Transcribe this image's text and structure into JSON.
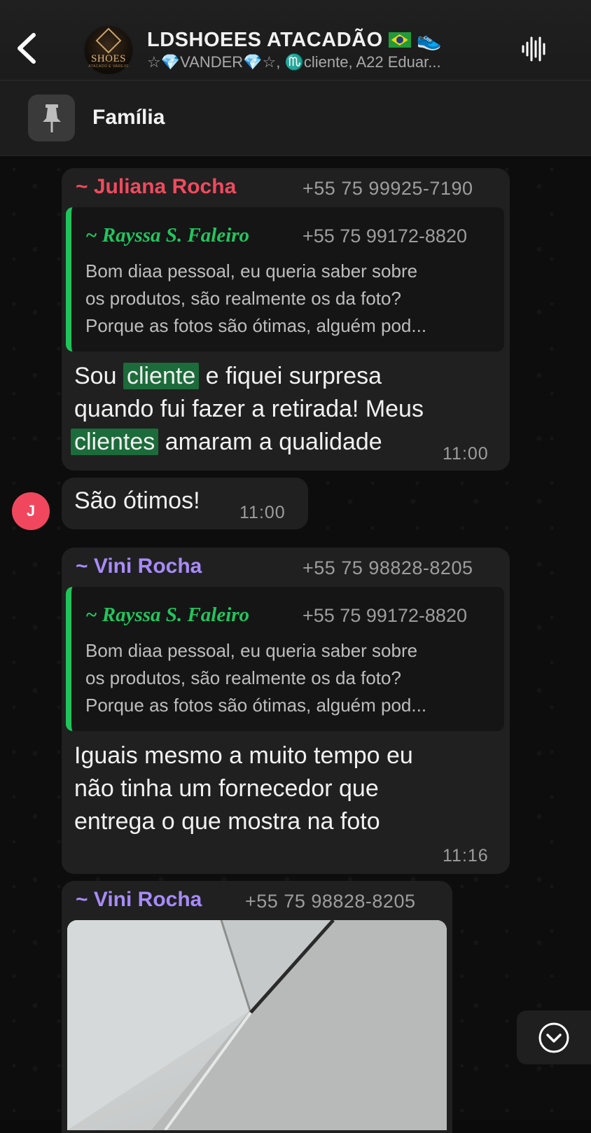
{
  "header": {
    "title": "LDSHOEES  ATACADÃO",
    "title_emoji": "👟",
    "subtitle": "☆💎VANDER💎☆, ♏cliente, A22 Eduar...",
    "avatar_text": "SHOES",
    "avatar_subtext": "ATACADO E VAREJO",
    "back_icon": "chevron-left-icon",
    "voice_icon": "voice-waveform-icon"
  },
  "pinned": {
    "label": "Família",
    "icon": "pin-icon"
  },
  "messages": [
    {
      "sender": "~ Juliana Rocha",
      "sender_color": "#f04a5e",
      "phone": "+55 75 99925-7190",
      "quote": {
        "name": "~ Rayssa S. Faleiro",
        "phone": "+55 75 99172-8820",
        "lines": [
          "Bom diaa pessoal, eu queria saber sobre",
          "os produtos, são realmente os da foto?",
          "Porque as fotos são ótimas, alguém pod..."
        ]
      },
      "text": {
        "l1_a": "Sou ",
        "l1_hl": "cliente",
        "l1_b": " e fiquei surpresa",
        "l2": "quando fui fazer a retirada! Meus",
        "l3_hl": "clientes",
        "l3_b": " amaram a qualidade"
      },
      "time": "11:00"
    },
    {
      "text": "São ótimos!",
      "time": "11:00",
      "avatar_initial": "J",
      "avatar_color": "#f0475e"
    },
    {
      "sender": "~ Vini Rocha",
      "sender_color": "#a78bfa",
      "phone": "+55 75 98828-8205",
      "quote": {
        "name": "~ Rayssa S. Faleiro",
        "phone": "+55 75 99172-8820",
        "lines": [
          "Bom diaa pessoal, eu queria saber sobre",
          "os produtos, são realmente os da foto?",
          "Porque as fotos são ótimas, alguém pod..."
        ]
      },
      "lines": [
        "Iguais mesmo a muito tempo eu",
        "não tinha um fornecedor que",
        "entrega o que mostra na foto"
      ],
      "time": "11:16"
    },
    {
      "sender": "~ Vini Rocha",
      "sender_color": "#a78bfa",
      "phone": "+55 75 98828-8205"
    }
  ],
  "scroll_down_icon": "chevron-down-circle-icon"
}
